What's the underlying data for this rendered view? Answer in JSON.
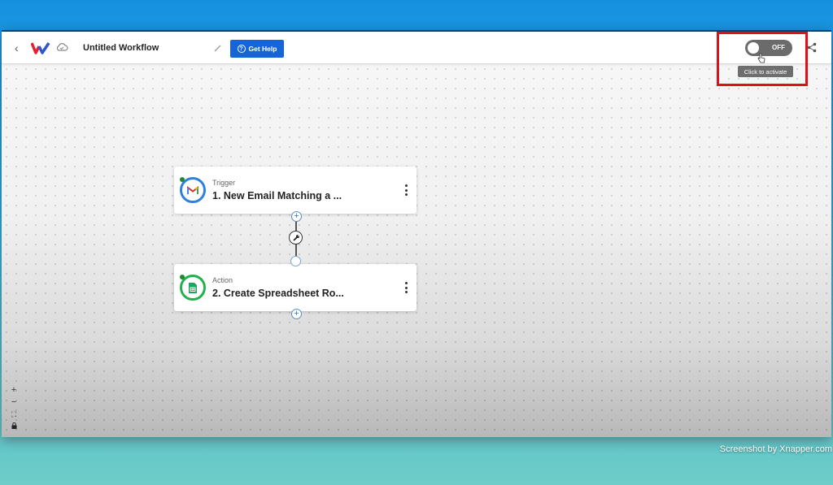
{
  "header": {
    "back_icon": "chevron-left-icon",
    "logo": "w-brand-logo",
    "sync_icon": "cloud-icon",
    "title": "Untitled Workflow",
    "edit_icon": "pencil-icon",
    "help_label": "Get Help",
    "help_icon": "question-circle-icon",
    "toggle": {
      "state_label": "OFF",
      "active": false
    },
    "tooltip": "Click to activate",
    "share_icon": "share-icon"
  },
  "workflow": {
    "nodes": [
      {
        "kind": "Trigger",
        "name": "1. New Email Matching a ...",
        "app": "Gmail",
        "icon": "gmail-icon",
        "ring_color": "#2f7fdc"
      },
      {
        "kind": "Action",
        "name": "2. Create Spreadsheet Ro...",
        "app": "Google Sheets",
        "icon": "google-sheets-icon",
        "ring_color": "#22b24c"
      }
    ],
    "connector_icon": "wrench-icon",
    "add_symbol": "+"
  },
  "zoom_controls": {
    "zoom_in": "+",
    "zoom_out": "−",
    "fit": "⛶",
    "lock": "🔒"
  },
  "watermark": "Screenshot by Xnapper.com",
  "colors": {
    "accent": "#1565d8",
    "highlight": "#e0101a",
    "toggle_off": "#6b6b6b"
  }
}
